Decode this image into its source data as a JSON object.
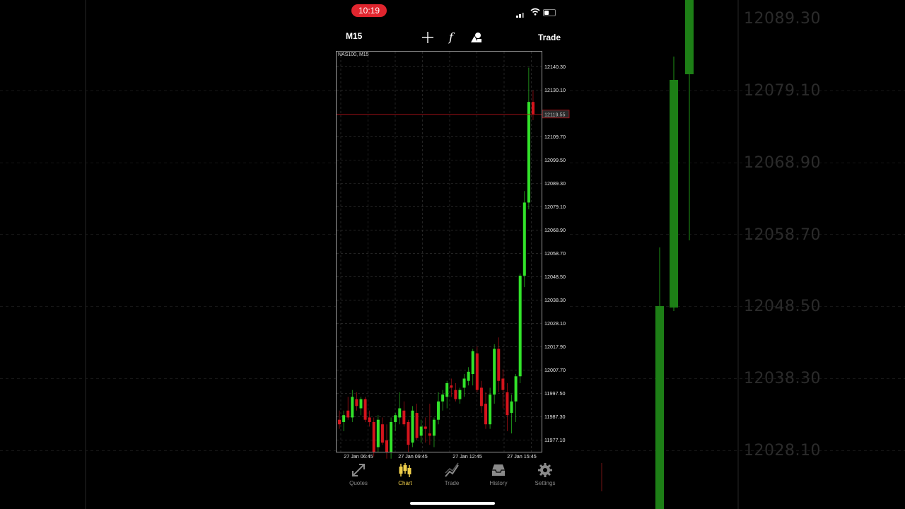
{
  "status_bar": {
    "time": "10:19"
  },
  "toolbar": {
    "timeframe": "M15",
    "crosshair_icon": "crosshair-icon",
    "indicators_icon": "function-icon",
    "objects_icon": "shapes-icon",
    "trade_label": "Trade"
  },
  "chart": {
    "symbol_label": "NAS100, M15",
    "bid_price": "12119.55",
    "price_levels": [
      "12140.30",
      "12130.10",
      "12109.70",
      "12099.50",
      "12089.30",
      "12079.10",
      "12068.90",
      "12058.70",
      "12048.50",
      "12038.30",
      "12028.10",
      "12017.90",
      "12007.70",
      "11997.50",
      "11987.30",
      "11977.10"
    ],
    "time_labels": [
      "27 Jan 06:45",
      "27 Jan 09:45",
      "27 Jan 12:45",
      "27 Jan 15:45"
    ],
    "colors": {
      "bull": "#32e32a",
      "bear": "#d4141c",
      "grid": "#3a3a3a",
      "bid_line": "#b3121a"
    }
  },
  "chart_data": {
    "type": "candlestick",
    "title": "NAS100, M15",
    "ylim": [
      11972,
      12147
    ],
    "y_ticks": [
      "12140.30",
      "12130.10",
      "12109.70",
      "12099.50",
      "12089.30",
      "12079.10",
      "12068.90",
      "12058.70",
      "12048.50",
      "12038.30",
      "12028.10",
      "12017.90",
      "12007.70",
      "11997.50",
      "11987.30",
      "11977.10"
    ],
    "x_ticks": [
      "27 Jan 06:45",
      "27 Jan 09:45",
      "27 Jan 12:45",
      "27 Jan 15:45"
    ],
    "last_price": 12119.55,
    "candles": [
      {
        "o": 11986,
        "h": 11990,
        "l": 11982,
        "c": 11984
      },
      {
        "o": 11985,
        "h": 11990,
        "l": 11981,
        "c": 11988
      },
      {
        "o": 11990,
        "h": 11996,
        "l": 11986,
        "c": 11987
      },
      {
        "o": 11987,
        "h": 11999,
        "l": 11985,
        "c": 11996
      },
      {
        "o": 11995,
        "h": 11998,
        "l": 11990,
        "c": 11992
      },
      {
        "o": 11991,
        "h": 11996,
        "l": 11988,
        "c": 11995
      },
      {
        "o": 11995,
        "h": 11996,
        "l": 11985,
        "c": 11986
      },
      {
        "o": 11987,
        "h": 11990,
        "l": 11983,
        "c": 11985
      },
      {
        "o": 11985,
        "h": 11987,
        "l": 11970,
        "c": 11972
      },
      {
        "o": 11974,
        "h": 11988,
        "l": 11972,
        "c": 11986
      },
      {
        "o": 11984,
        "h": 11987,
        "l": 11975,
        "c": 11976
      },
      {
        "o": 11977,
        "h": 11984,
        "l": 11969,
        "c": 11972
      },
      {
        "o": 11972,
        "h": 11987,
        "l": 11969,
        "c": 11985
      },
      {
        "o": 11985,
        "h": 11989,
        "l": 11981,
        "c": 11988
      },
      {
        "o": 11987,
        "h": 11998,
        "l": 11984,
        "c": 11991
      },
      {
        "o": 11990,
        "h": 11994,
        "l": 11983,
        "c": 11984
      },
      {
        "o": 11985,
        "h": 11986,
        "l": 11972,
        "c": 11975
      },
      {
        "o": 11976,
        "h": 11992,
        "l": 11974,
        "c": 11990
      },
      {
        "o": 11989,
        "h": 11993,
        "l": 11977,
        "c": 11978
      },
      {
        "o": 11979,
        "h": 11986,
        "l": 11976,
        "c": 11983
      },
      {
        "o": 11983,
        "h": 11987,
        "l": 11976,
        "c": 11982
      },
      {
        "o": 11980,
        "h": 11993,
        "l": 11975,
        "c": 11979
      },
      {
        "o": 11979,
        "h": 11987,
        "l": 11974,
        "c": 11986
      },
      {
        "o": 11986,
        "h": 11998,
        "l": 11984,
        "c": 11994
      },
      {
        "o": 11994,
        "h": 11999,
        "l": 11990,
        "c": 11997
      },
      {
        "o": 11996,
        "h": 12003,
        "l": 11991,
        "c": 12002
      },
      {
        "o": 12001,
        "h": 12004,
        "l": 11996,
        "c": 12000
      },
      {
        "o": 11999,
        "h": 12002,
        "l": 11994,
        "c": 11995
      },
      {
        "o": 11995,
        "h": 12000,
        "l": 11993,
        "c": 11999
      },
      {
        "o": 12000,
        "h": 12006,
        "l": 11996,
        "c": 12004
      },
      {
        "o": 12003,
        "h": 12009,
        "l": 12001,
        "c": 12007
      },
      {
        "o": 12006,
        "h": 12017,
        "l": 12001,
        "c": 12016
      },
      {
        "o": 12015,
        "h": 12018,
        "l": 11998,
        "c": 11999
      },
      {
        "o": 12000,
        "h": 12003,
        "l": 11989,
        "c": 11992
      },
      {
        "o": 11993,
        "h": 11998,
        "l": 11982,
        "c": 11984
      },
      {
        "o": 11984,
        "h": 12000,
        "l": 11982,
        "c": 11997
      },
      {
        "o": 11997,
        "h": 12019,
        "l": 11993,
        "c": 12017
      },
      {
        "o": 12017,
        "h": 12022,
        "l": 11998,
        "c": 12003
      },
      {
        "o": 12004,
        "h": 12008,
        "l": 11991,
        "c": 11999
      },
      {
        "o": 11998,
        "h": 12002,
        "l": 11981,
        "c": 11988
      },
      {
        "o": 11989,
        "h": 11997,
        "l": 11980,
        "c": 11994
      },
      {
        "o": 11994,
        "h": 12006,
        "l": 11985,
        "c": 12005
      },
      {
        "o": 12005,
        "h": 12050,
        "l": 12002,
        "c": 12049
      },
      {
        "o": 12049,
        "h": 12086,
        "l": 12044,
        "c": 12081
      },
      {
        "o": 12081,
        "h": 12140,
        "l": 12078,
        "c": 12125
      },
      {
        "o": 12125,
        "h": 12130,
        "l": 12117,
        "c": 12119.55
      }
    ]
  },
  "backdrop": {
    "price_labels": [
      "12089.30",
      "12079.10",
      "12068.90",
      "12058.70",
      "12048.50",
      "12038.30",
      "12028.10"
    ]
  },
  "tabs": [
    {
      "label": "Quotes",
      "icon": "quotes-icon"
    },
    {
      "label": "Chart",
      "icon": "chart-icon"
    },
    {
      "label": "Trade",
      "icon": "trade-icon"
    },
    {
      "label": "History",
      "icon": "history-icon"
    },
    {
      "label": "Settings",
      "icon": "settings-icon"
    }
  ]
}
